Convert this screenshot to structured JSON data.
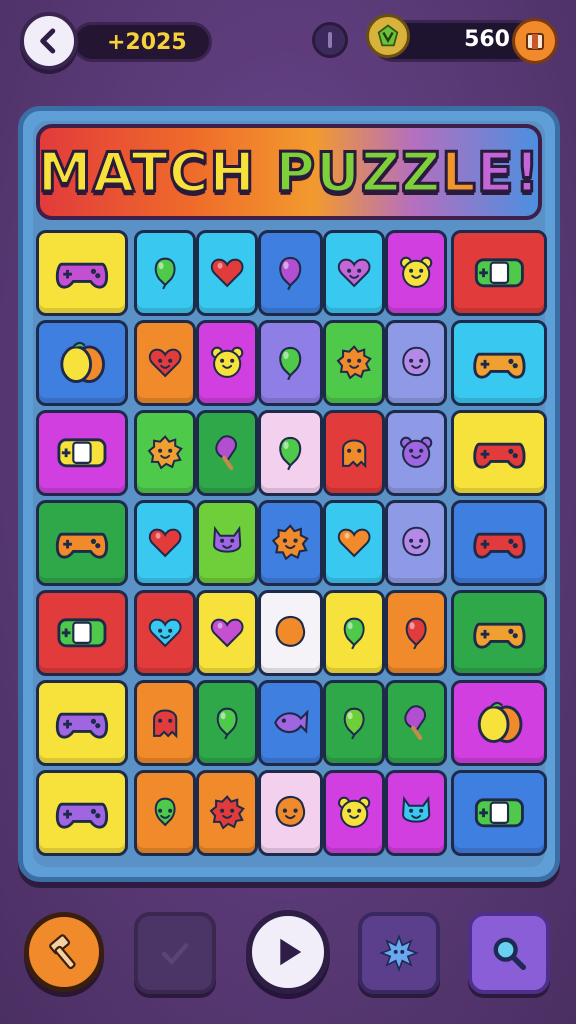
{
  "header": {
    "score": "+2025",
    "coins": "560"
  },
  "title": {
    "part1": "MATCH ",
    "part2": "PUZZ",
    "part3": "L",
    "part4": "E",
    "part5": "!"
  },
  "grid": {
    "rows": [
      [
        {
          "icon": "gamepad",
          "bg": "#f6e23a",
          "fg": "#c44fd0"
        },
        {
          "icon": "balloon",
          "bg": "#39c8ef",
          "fg": "#4fc94a"
        },
        {
          "icon": "heart",
          "bg": "#39c8ef",
          "fg": "#e23b3b"
        },
        {
          "icon": "balloon",
          "bg": "#3f7fe0",
          "fg": "#b24fd0"
        },
        {
          "icon": "heart-face",
          "bg": "#39c8ef",
          "fg": "#c266d8"
        },
        {
          "icon": "bear-face",
          "bg": "#d23fe0",
          "fg": "#f6e23a"
        },
        {
          "icon": "switch-console",
          "bg": "#e23b3b",
          "fg": "#4fc94a"
        }
      ],
      [
        {
          "icon": "lemons",
          "bg": "#3f7fe0",
          "fg": "#f6e23a"
        },
        {
          "icon": "heart-face",
          "bg": "#f08a2b",
          "fg": "#e23b3b"
        },
        {
          "icon": "bear-face",
          "bg": "#d23fe0",
          "fg": "#f6e23a"
        },
        {
          "icon": "balloon",
          "bg": "#8f7ee6",
          "fg": "#4fc94a"
        },
        {
          "icon": "flower-face",
          "bg": "#4fc94a",
          "fg": "#f08a2b"
        },
        {
          "icon": "blob-face",
          "bg": "#8f9ae6",
          "fg": "#b48ae6"
        },
        {
          "icon": "gamepad",
          "bg": "#39c8ef",
          "fg": "#f0a030"
        }
      ],
      [
        {
          "icon": "switch-console",
          "bg": "#d23fe0",
          "fg": "#f6e23a"
        },
        {
          "icon": "flower-face",
          "bg": "#4fc94a",
          "fg": "#f0a030"
        },
        {
          "icon": "popsicle",
          "bg": "#2fa84a",
          "fg": "#b24fd0"
        },
        {
          "icon": "balloon",
          "bg": "#f4d0ef",
          "fg": "#4fc94a"
        },
        {
          "icon": "ghost-face",
          "bg": "#e23b3b",
          "fg": "#f08a2b"
        },
        {
          "icon": "bear-face",
          "bg": "#8f9ae6",
          "fg": "#a065e0"
        },
        {
          "icon": "gamepad",
          "bg": "#f6e23a",
          "fg": "#e23b3b"
        }
      ],
      [
        {
          "icon": "gamepad",
          "bg": "#2fa84a",
          "fg": "#f08a2b"
        },
        {
          "icon": "heart",
          "bg": "#39c8ef",
          "fg": "#e23b3b"
        },
        {
          "icon": "cat-face",
          "bg": "#6fcf3a",
          "fg": "#a065e0"
        },
        {
          "icon": "flower-face",
          "bg": "#3f7fe0",
          "fg": "#f08a2b"
        },
        {
          "icon": "heart",
          "bg": "#39c8ef",
          "fg": "#f08a2b"
        },
        {
          "icon": "blob-face",
          "bg": "#8f9ae6",
          "fg": "#b48ae6"
        },
        {
          "icon": "gamepad",
          "bg": "#3f7fe0",
          "fg": "#e23b3b"
        }
      ],
      [
        {
          "icon": "switch-console",
          "bg": "#e23b3b",
          "fg": "#4fc94a"
        },
        {
          "icon": "heart-face",
          "bg": "#e23b3b",
          "fg": "#39c8ef"
        },
        {
          "icon": "heart",
          "bg": "#f6e23a",
          "fg": "#c44fd0"
        },
        {
          "icon": "blob",
          "bg": "#f5f3f8",
          "fg": "#f08a2b"
        },
        {
          "icon": "balloon",
          "bg": "#f6e23a",
          "fg": "#4fc94a"
        },
        {
          "icon": "balloon",
          "bg": "#f08a2b",
          "fg": "#e23b3b"
        },
        {
          "icon": "gamepad",
          "bg": "#2fa84a",
          "fg": "#f0a030"
        }
      ],
      [
        {
          "icon": "gamepad",
          "bg": "#f6e23a",
          "fg": "#a065e0"
        },
        {
          "icon": "ghost-face",
          "bg": "#f08a2b",
          "fg": "#e23b3b"
        },
        {
          "icon": "balloon",
          "bg": "#2fa84a",
          "fg": "#4fc94a"
        },
        {
          "icon": "fish",
          "bg": "#3f7fe0",
          "fg": "#a065e0"
        },
        {
          "icon": "balloon",
          "bg": "#2fa84a",
          "fg": "#6fcf3a"
        },
        {
          "icon": "popsicle",
          "bg": "#2fa84a",
          "fg": "#b24fd0"
        },
        {
          "icon": "lemons",
          "bg": "#d23fe0",
          "fg": "#f6e23a"
        }
      ],
      [
        {
          "icon": "gamepad",
          "bg": "#f6e23a",
          "fg": "#a065e0"
        },
        {
          "icon": "balloon-face",
          "bg": "#f08a2b",
          "fg": "#4fc94a"
        },
        {
          "icon": "flower-face",
          "bg": "#f08a2b",
          "fg": "#e23b3b"
        },
        {
          "icon": "blob-face",
          "bg": "#f4d0ef",
          "fg": "#f08a2b"
        },
        {
          "icon": "bear-face",
          "bg": "#d23fe0",
          "fg": "#f6e23a"
        },
        {
          "icon": "cat-face",
          "bg": "#d23fe0",
          "fg": "#39c8ef"
        },
        {
          "icon": "switch-console",
          "bg": "#3f7fe0",
          "fg": "#4fc94a"
        }
      ]
    ]
  },
  "bottom_bar": [
    {
      "name": "hammer-button",
      "icon": "hammer-icon"
    },
    {
      "name": "check-button",
      "icon": "check-icon"
    },
    {
      "name": "play-button",
      "icon": "play-icon"
    },
    {
      "name": "star-button",
      "icon": "splat-star-icon"
    },
    {
      "name": "search-button",
      "icon": "magnifier-icon"
    }
  ]
}
